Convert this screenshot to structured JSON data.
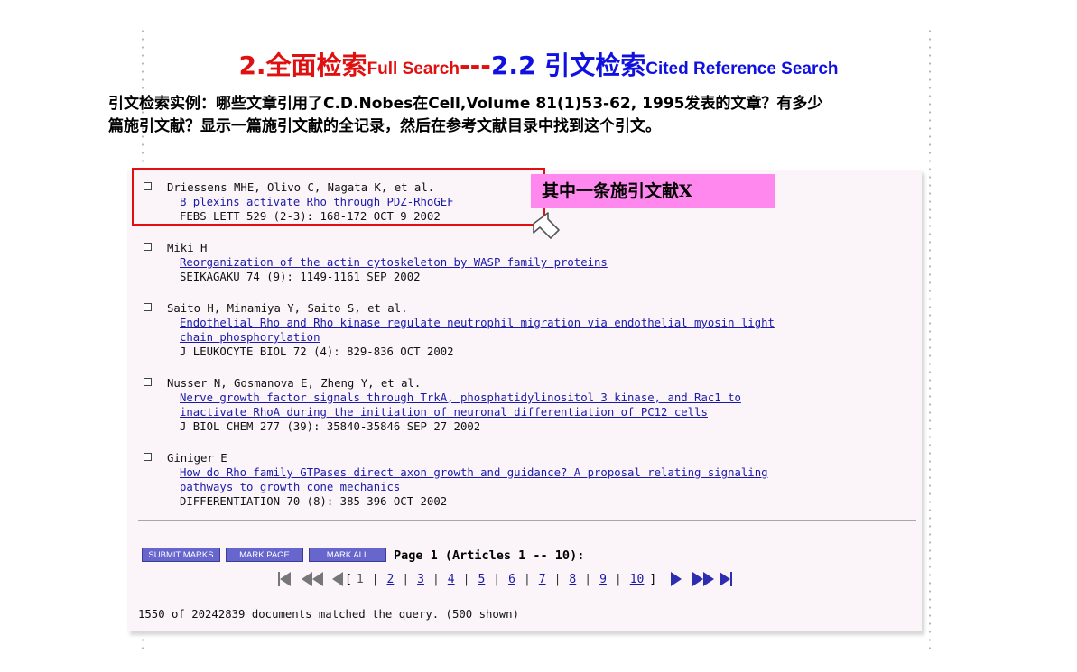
{
  "title": {
    "part1": "2.全面检索",
    "part2": "Full Search",
    "part3": "---",
    "part4": "2.2 引文检索",
    "part5": "Cited Reference Search"
  },
  "description": {
    "line1": "引文检索实例：哪些文章引用了C.D.Nobes在Cell,Volume 81(1)53-62, 1995发表的文章？有多少",
    "line2": "篇施引文献？显示一篇施引文献的全记录，然后在参考文献目录中找到这个引文。"
  },
  "records": [
    {
      "authors": "Driessens MHE, Olivo C, Nagata K, et al.",
      "title1": "B plexins activate Rho through PDZ-RhoGEF",
      "title2": "",
      "source": "FEBS LETT 529 (2-3): 168-172 OCT 9 2002"
    },
    {
      "authors": "Miki H",
      "title1": "Reorganization of the actin cytoskeleton by WASP family proteins",
      "title2": "",
      "source": "SEIKAGAKU 74 (9): 1149-1161 SEP 2002"
    },
    {
      "authors": "Saito H, Minamiya Y, Saito S, et al.",
      "title1": "Endothelial Rho and Rho kinase regulate neutrophil migration via endothelial myosin light",
      "title2": "chain phosphorylation",
      "source": "J LEUKOCYTE BIOL 72 (4): 829-836 OCT 2002"
    },
    {
      "authors": "Nusser N, Gosmanova E, Zheng Y, et al.",
      "title1": "Nerve growth factor signals through TrkA, phosphatidylinositol 3 kinase, and Rac1 to",
      "title2": "inactivate RhoA during the initiation of neuronal differentiation of PC12 cells",
      "source": "J BIOL CHEM 277 (39): 35840-35846 SEP 27 2002"
    },
    {
      "authors": "Giniger E",
      "title1": "How do Rho family GTPases direct axon growth and guidance? A proposal relating signaling",
      "title2": "pathways to growth cone mechanics",
      "source": "DIFFERENTIATION 70 (8): 385-396 OCT 2002"
    }
  ],
  "buttons": {
    "submit_marks": "SUBMIT MARKS",
    "mark_page": "MARK PAGE",
    "mark_all": "MARK ALL"
  },
  "page_info": "Page 1 (Articles 1 -- 10):",
  "pager": {
    "open_bracket": "[",
    "close_bracket": "]",
    "pages": [
      "1",
      "2",
      "3",
      "4",
      "5",
      "6",
      "7",
      "8",
      "9",
      "10"
    ]
  },
  "footer": "1550 of 20242839 documents matched the query. (500 shown)",
  "callout": "其中一条施引文献X",
  "colors": {
    "accent_red": "#e01010",
    "accent_blue": "#1010e0",
    "link": "#1a1aa8",
    "callout_bg": "#ff88ee",
    "button": "#6666cc"
  }
}
